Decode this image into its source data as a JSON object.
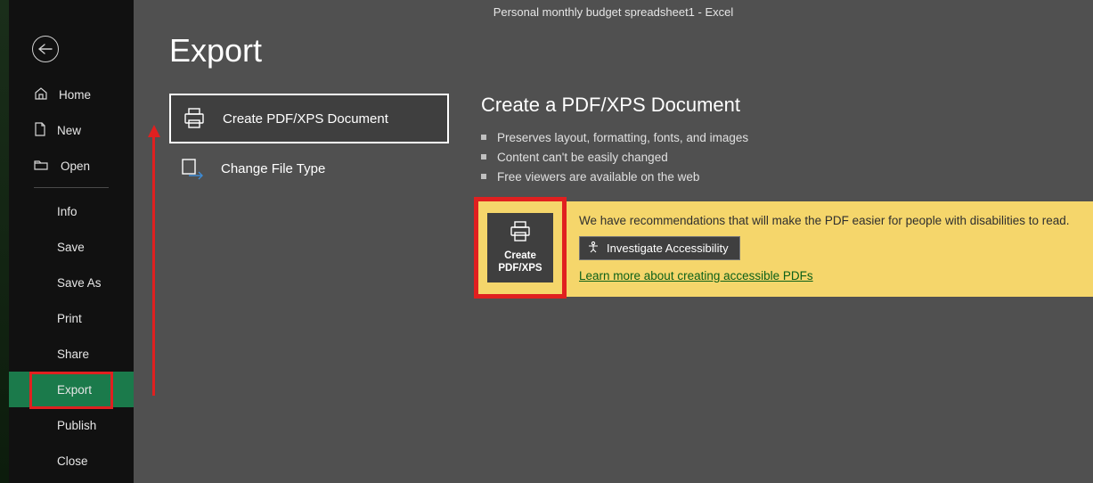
{
  "titlebar": {
    "document": "Personal monthly budget spreadsheet1",
    "separator": "  -  ",
    "app": "Excel"
  },
  "sidebar": {
    "items": [
      {
        "label": "Home"
      },
      {
        "label": "New"
      },
      {
        "label": "Open"
      },
      {
        "label": "Info"
      },
      {
        "label": "Save"
      },
      {
        "label": "Save As"
      },
      {
        "label": "Print"
      },
      {
        "label": "Share"
      },
      {
        "label": "Export"
      },
      {
        "label": "Publish"
      },
      {
        "label": "Close"
      }
    ]
  },
  "page": {
    "title": "Export"
  },
  "options": {
    "create_pdf": "Create PDF/XPS Document",
    "change_type": "Change File Type"
  },
  "panel": {
    "heading": "Create a PDF/XPS Document",
    "bullets": [
      "Preserves layout, formatting, fonts, and images",
      "Content can't be easily changed",
      "Free viewers are available on the web"
    ],
    "big_button": {
      "line1": "Create",
      "line2": "PDF/XPS"
    },
    "accessibility_note": "We have recommendations that will make the PDF easier for people with disabilities to read.",
    "investigate_label": "Investigate Accessibility",
    "learn_link": "Learn more about creating accessible PDFs"
  }
}
